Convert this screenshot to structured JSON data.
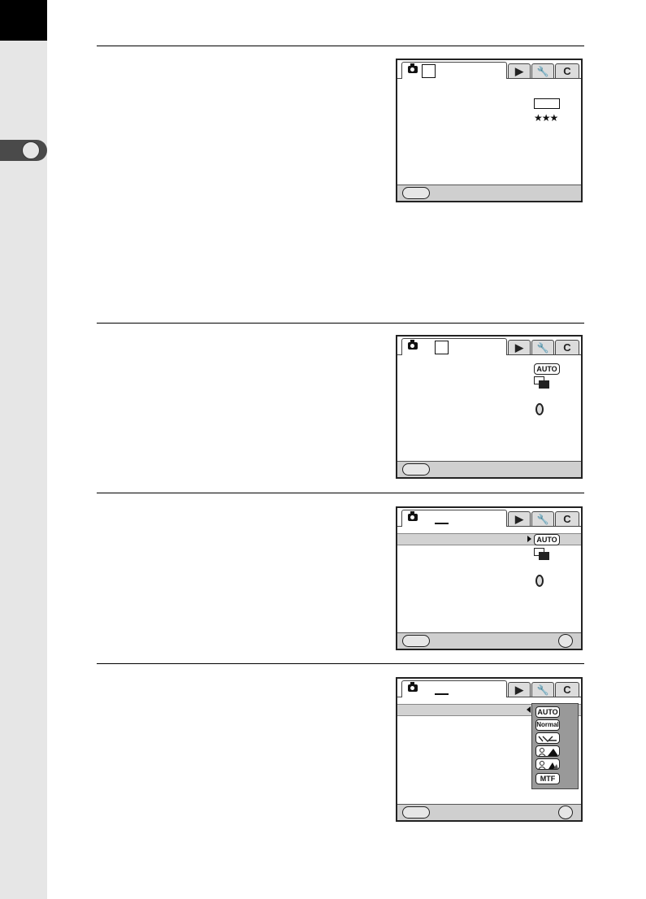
{
  "menu_tabs": {
    "playback_icon": "play-icon",
    "setup_icon": "wrench-icon",
    "custom_label": "C"
  },
  "popup_options": [
    "AUTO",
    "Normal"
  ],
  "popup_last_option": "MTF",
  "badges": {
    "auto": "AUTO"
  },
  "quality_stars": "★★★"
}
